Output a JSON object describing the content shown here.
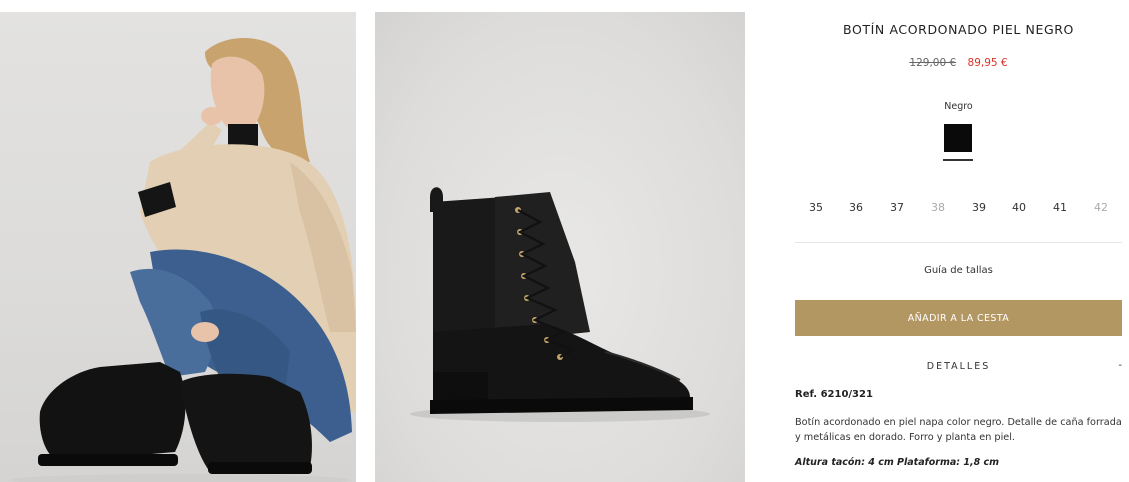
{
  "product": {
    "title": "BOTÍN ACORDONADO PIEL NEGRO",
    "price_old": "129,00 €",
    "price_new": "89,95 €",
    "color_label": "Negro",
    "swatch_color": "#0a0a0a"
  },
  "sizes": [
    {
      "label": "35",
      "available": true
    },
    {
      "label": "36",
      "available": true
    },
    {
      "label": "37",
      "available": true
    },
    {
      "label": "38",
      "available": false
    },
    {
      "label": "39",
      "available": true
    },
    {
      "label": "40",
      "available": true
    },
    {
      "label": "41",
      "available": true
    },
    {
      "label": "42",
      "available": false
    }
  ],
  "size_guide_label": "Guía de tallas",
  "add_to_cart_label": "AÑADIR A LA CESTA",
  "details": {
    "label": "DETALLES",
    "toggle": "-",
    "ref": "Ref. 6210/321",
    "description": "Botín acordonado en piel napa color negro. Detalle de caña forrada y metálicas en dorado. Forro y planta en piel.",
    "measures": "Altura tacón: 4 cm Plataforma: 1,8 cm"
  },
  "colors": {
    "accent": "#b39763",
    "sale_price": "#d9342b"
  },
  "images": [
    {
      "name": "model-photo",
      "subject": "woman-sitting-wearing-black-lace-up-boots"
    },
    {
      "name": "boot-photo",
      "subject": "black-lace-up-leather-ankle-boot"
    }
  ]
}
